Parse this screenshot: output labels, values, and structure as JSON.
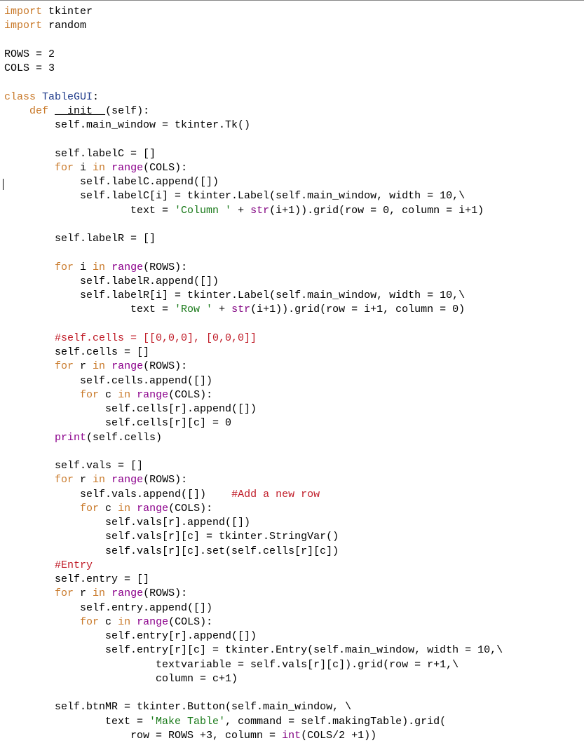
{
  "code": {
    "line01": {
      "kw": "import",
      "mod": " tkinter"
    },
    "line02": {
      "kw": "import",
      "mod": " random"
    },
    "line03": "",
    "line04": "ROWS = 2",
    "line05": "COLS = 3",
    "line06": "",
    "line07": {
      "kw": "class",
      "name": " TableGUI",
      "rest": ":"
    },
    "line08": {
      "indent": "    ",
      "kw": "def",
      "sp": " ",
      "dunder": "__init__",
      "rest": "(self):"
    },
    "line09": "        self.main_window = tkinter.Tk()",
    "line10": "",
    "line11": "        self.labelC = []",
    "line12": {
      "indent": "        ",
      "kw1": "for",
      "var": " i ",
      "kw2": "in",
      "sp": " ",
      "fn": "range",
      "rest": "(COLS):"
    },
    "line13": "            self.labelC.append([])",
    "line14": "            self.labelC[i] = tkinter.Label(self.main_window, width = 10,\\",
    "line15": {
      "lead": "                    text = ",
      "str": "'Column '",
      "mid": " + ",
      "fn": "str",
      "rest": "(i+1)).grid(row = 0, column = i+1)"
    },
    "line16": "",
    "line17": "        self.labelR = []",
    "line18": "",
    "line19": {
      "indent": "        ",
      "kw1": "for",
      "var": " i ",
      "kw2": "in",
      "sp": " ",
      "fn": "range",
      "rest": "(ROWS):"
    },
    "line20": "            self.labelR.append([])",
    "line21": "            self.labelR[i] = tkinter.Label(self.main_window, width = 10,\\",
    "line22": {
      "lead": "                    text = ",
      "str": "'Row '",
      "mid": " + ",
      "fn": "str",
      "rest": "(i+1)).grid(row = i+1, column = 0)"
    },
    "line23": "",
    "line24": {
      "indent": "        ",
      "cmt": "#self.cells = [[0,0,0], [0,0,0]]"
    },
    "line25": "        self.cells = []",
    "line26": {
      "indent": "        ",
      "kw1": "for",
      "var": " r ",
      "kw2": "in",
      "sp": " ",
      "fn": "range",
      "rest": "(ROWS):"
    },
    "line27": "            self.cells.append([])",
    "line28": {
      "indent": "            ",
      "kw1": "for",
      "var": " c ",
      "kw2": "in",
      "sp": " ",
      "fn": "range",
      "rest": "(COLS):"
    },
    "line29": "                self.cells[r].append([])",
    "line30": "                self.cells[r][c] = 0",
    "line31": {
      "indent": "        ",
      "fn": "print",
      "rest": "(self.cells)"
    },
    "line32": "",
    "line33": "        self.vals = []",
    "line34": {
      "indent": "        ",
      "kw1": "for",
      "var": " r ",
      "kw2": "in",
      "sp": " ",
      "fn": "range",
      "rest": "(ROWS):"
    },
    "line35": {
      "lead": "            self.vals.append([])    ",
      "cmt": "#Add a new row"
    },
    "line36": {
      "indent": "            ",
      "kw1": "for",
      "var": " c ",
      "kw2": "in",
      "sp": " ",
      "fn": "range",
      "rest": "(COLS):"
    },
    "line37": "                self.vals[r].append([])",
    "line38": "                self.vals[r][c] = tkinter.StringVar()",
    "line39": "                self.vals[r][c].set(self.cells[r][c])",
    "line40": {
      "indent": "        ",
      "cmt": "#Entry"
    },
    "line41": "        self.entry = []",
    "line42": {
      "indent": "        ",
      "kw1": "for",
      "var": " r ",
      "kw2": "in",
      "sp": " ",
      "fn": "range",
      "rest": "(ROWS):"
    },
    "line43": "            self.entry.append([])",
    "line44": {
      "indent": "            ",
      "kw1": "for",
      "var": " c ",
      "kw2": "in",
      "sp": " ",
      "fn": "range",
      "rest": "(COLS):"
    },
    "line45": "                self.entry[r].append([])",
    "line46": "                self.entry[r][c] = tkinter.Entry(self.main_window, width = 10,\\",
    "line47": "                        textvariable = self.vals[r][c]).grid(row = r+1,\\",
    "line48": "                        column = c+1)",
    "line49": "",
    "line50": "        self.btnMR = tkinter.Button(self.main_window, \\",
    "line51": {
      "lead": "                text = ",
      "str": "'Make Table'",
      "rest": ", command = self.makingTable).grid("
    },
    "line52": {
      "lead": "                    row = ROWS +3, column = ",
      "fn": "int",
      "rest": "(COLS/2 +1))"
    }
  }
}
